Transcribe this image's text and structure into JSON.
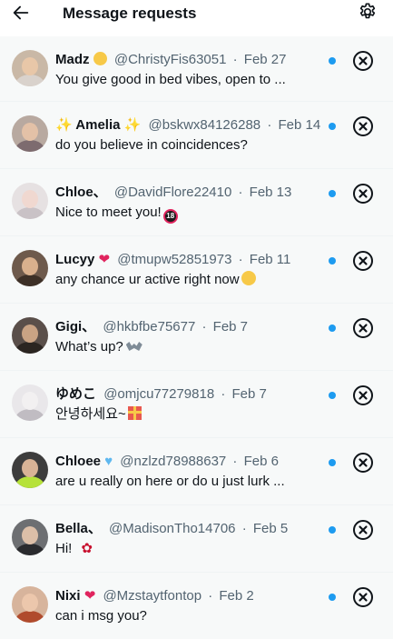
{
  "header": {
    "title": "Message requests",
    "back_icon": "arrow-left-icon",
    "settings_icon": "gear-icon"
  },
  "colors": {
    "accent": "#1d9bf0",
    "row_background": "#f7f9f9",
    "secondary_text": "#536471"
  },
  "requests": [
    {
      "name": "Madz",
      "name_emoji": "relieved-face-emoji",
      "handle": "@ChristyFis63051",
      "separator": "·",
      "date": "Feb 27",
      "preview": "You give good in bed vibes, open to ...",
      "unread": true
    },
    {
      "name": "✨ Amelia ✨",
      "handle": "@bskwx84126288",
      "separator": "·",
      "date": "Feb 14",
      "preview": "do you believe in coincidences?",
      "unread": true
    },
    {
      "name": "Chloe、",
      "handle": "@DavidFlore22410",
      "separator": "·",
      "date": "Feb 13",
      "preview": "Nice to meet you!",
      "preview_emoji_text": "18",
      "unread": true
    },
    {
      "name": "Lucyy",
      "name_emoji": "heart-with-ribbon-emoji",
      "handle": "@tmupw52851973",
      "separator": "·",
      "date": "Feb 11",
      "preview": "any chance ur active right now",
      "preview_emoji": "tired-face-emoji",
      "unread": true
    },
    {
      "name": "Gigi、",
      "handle": "@hkbfbe75677",
      "separator": "·",
      "date": "Feb 7",
      "preview": "What’s up?",
      "preview_emoji": "bat-emoji",
      "unread": true
    },
    {
      "name": "ゆめこ",
      "handle": "@omjcu77279818",
      "separator": "·",
      "date": "Feb 7",
      "preview": "안녕하세요~",
      "preview_emoji": "gift-emoji",
      "unread": true
    },
    {
      "name": "Chloee",
      "name_emoji": "blue-heart-emoji",
      "handle": "@nzlzd78988637",
      "separator": "·",
      "date": "Feb 6",
      "preview": "are u really on here or do u just lurk ...",
      "unread": true
    },
    {
      "name": "Bella、",
      "handle": "@MadisonTho14706",
      "separator": "·",
      "date": "Feb 5",
      "preview": "Hi!",
      "preview_emoji": "rose-emoji",
      "unread": true
    },
    {
      "name": "Nixi",
      "name_emoji": "red-heart-emoji",
      "handle": "@Mzstaytfontop",
      "separator": "·",
      "date": "Feb 2",
      "preview": "can i msg you?",
      "unread": true
    }
  ],
  "avatars": [
    {
      "bg": "#c9b8a6",
      "face": "#e8c7a8",
      "body": "#d9d2cc"
    },
    {
      "bg": "#b8a9a0",
      "face": "#e3c1a7",
      "body": "#7d6b6f"
    },
    {
      "bg": "#e6e1e2",
      "face": "#f0d8d0",
      "body": "#c9c2c6"
    },
    {
      "bg": "#6e5a4c",
      "face": "#d9b08d",
      "body": "#3d3027"
    },
    {
      "bg": "#5a4f4a",
      "face": "#c9a384",
      "body": "#2b2521"
    },
    {
      "bg": "#e9e7ea",
      "face": "#f2f0f1",
      "body": "#c0bcc2"
    },
    {
      "bg": "#3d3d3d",
      "face": "#d8b396",
      "body": "#b6e23a"
    },
    {
      "bg": "#6d6f72",
      "face": "#dcbfa8",
      "body": "#2a2b2e"
    },
    {
      "bg": "#d7b49c",
      "face": "#ecc7ac",
      "body": "#b04b2d"
    }
  ]
}
